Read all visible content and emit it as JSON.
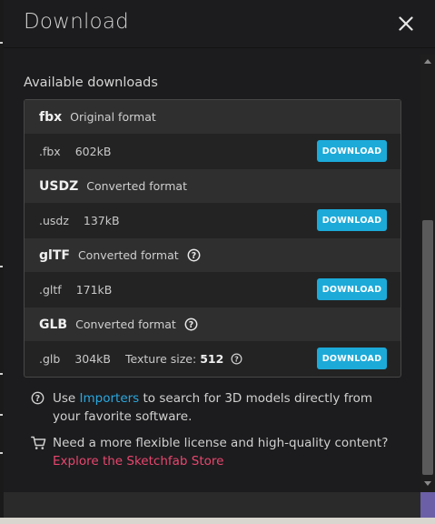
{
  "modal": {
    "title": "Download",
    "close_icon": "close-icon"
  },
  "downloads": {
    "section_label": "Available downloads",
    "button_label": "DOWNLOAD",
    "button_color": "#1caad9",
    "formats": [
      {
        "name": "fbx",
        "kind": "Original format",
        "ext": ".fbx",
        "size": "602kB"
      },
      {
        "name": "USDZ",
        "kind": "Converted format",
        "ext": ".usdz",
        "size": "137kB"
      },
      {
        "name": "glTF",
        "kind": "Converted format",
        "ext": ".gltf",
        "size": "171kB",
        "help_icon": "help-icon"
      },
      {
        "name": "GLB",
        "kind": "Converted format",
        "ext": ".glb",
        "size": "304kB",
        "help_icon": "help-icon",
        "texture_label": "Texture size:",
        "texture_value": "512"
      }
    ]
  },
  "info": {
    "importers": {
      "icon": "help-icon",
      "prefix": "Use ",
      "link": "Importers",
      "suffix": " to search for 3D models directly from your favorite software."
    },
    "store": {
      "icon": "cart-icon",
      "text": "Need a more flexible license and high-quality content?",
      "link": "Explore the Sketchfab Store",
      "link_color": "#e8466e"
    }
  }
}
